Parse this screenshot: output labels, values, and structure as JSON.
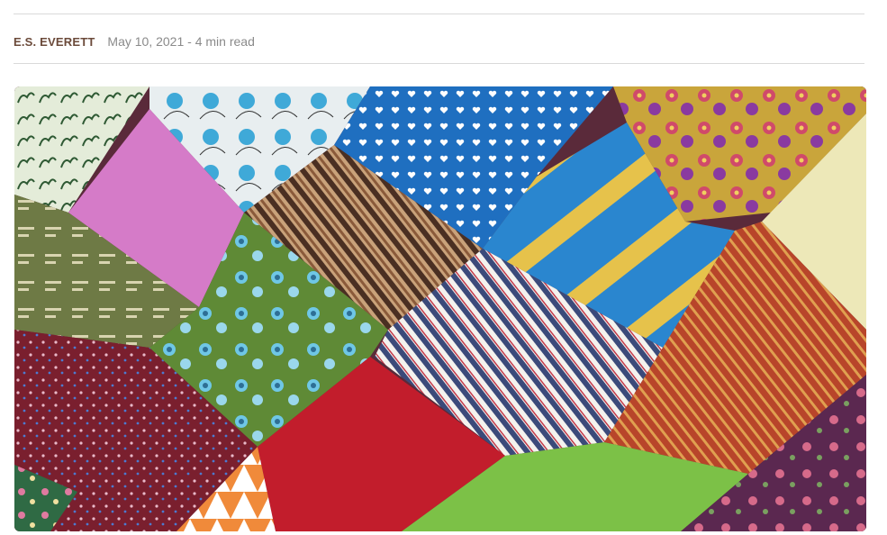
{
  "post_meta": {
    "author": "E.S. EVERETT",
    "date": "May 10, 2021",
    "separator": "-",
    "read_time": "4 min read"
  },
  "featured_image": {
    "alt": "",
    "colors": {
      "violet": "#d57bc8",
      "stripe_brown": "#6b4a33",
      "heart_blue": "#1f6fc0",
      "yellow_blue_stripe": "#e6c24b",
      "floral_olive": "#c9a53b",
      "cream": "#ede8b8",
      "floral_green": "#5f8a36",
      "navy_white_stripe": "#3b4a7a",
      "rust": "#b8452a",
      "crimson": "#c21d2c",
      "lime": "#7cc147",
      "plum": "#5b2850",
      "maroon_dots": "#7a1f2e",
      "olive_print": "#6e7a45",
      "orange_geo": "#f08a3a",
      "green_floral": "#2f6a44",
      "white_sketch": "#e8eef0",
      "green_toile": "#e4ecd9"
    }
  }
}
